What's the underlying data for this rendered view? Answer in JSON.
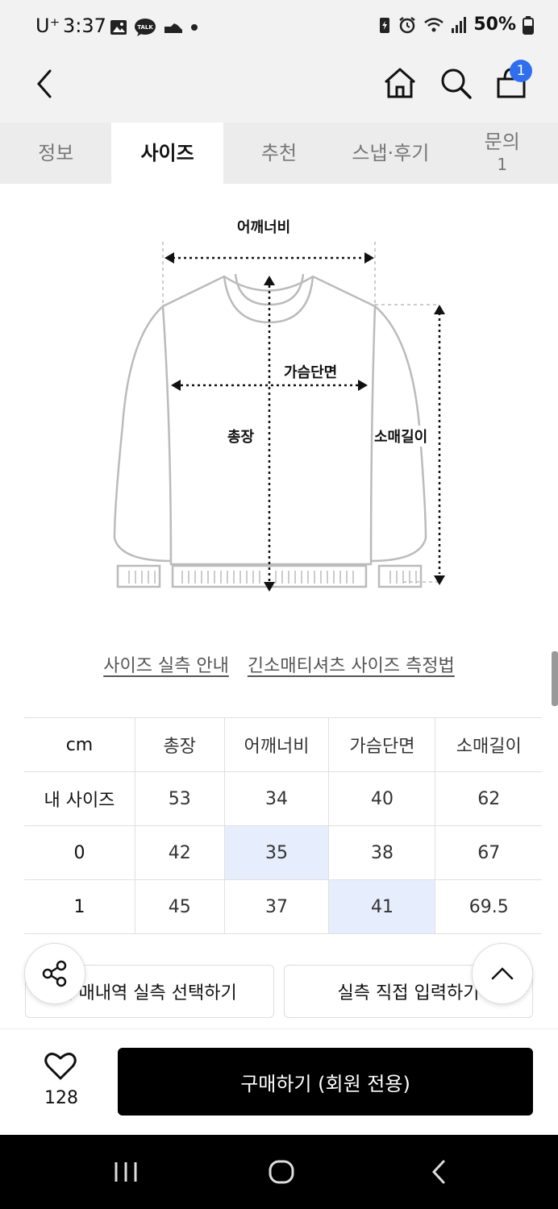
{
  "status_bar": {
    "carrier": "U⁺",
    "time": "3:37",
    "battery": "50%"
  },
  "header": {
    "cart_count": "1"
  },
  "tabs": [
    {
      "label": "정보",
      "sub": ""
    },
    {
      "label": "사이즈",
      "sub": ""
    },
    {
      "label": "추천",
      "sub": ""
    },
    {
      "label": "스냅·후기",
      "sub": ""
    },
    {
      "label": "문의",
      "sub": "1"
    }
  ],
  "diagram": {
    "shoulder": "어깨너비",
    "chest": "가슴단면",
    "length": "총장",
    "sleeve": "소매길이"
  },
  "links": {
    "guide": "사이즈 실측 안내",
    "method": "긴소매티셔츠 사이즈 측정법"
  },
  "size_table": {
    "headers": [
      "cm",
      "총장",
      "어깨너비",
      "가슴단면",
      "소매길이"
    ],
    "rows": [
      {
        "label": "내 사이즈",
        "values": [
          "53",
          "34",
          "40",
          "62"
        ]
      },
      {
        "label": "0",
        "values": [
          "42",
          "35",
          "38",
          "67"
        ]
      },
      {
        "label": "1",
        "values": [
          "45",
          "37",
          "41",
          "69.5"
        ]
      }
    ]
  },
  "actions": {
    "select_history": "구매내역 실측 선택하기",
    "manual_input": "실측 직접 입력하기"
  },
  "bottom": {
    "like_count": "128",
    "buy_label": "구매하기 (회원 전용)"
  },
  "colors": {
    "highlight": "#e6edfc",
    "badge": "#2f6fed"
  }
}
